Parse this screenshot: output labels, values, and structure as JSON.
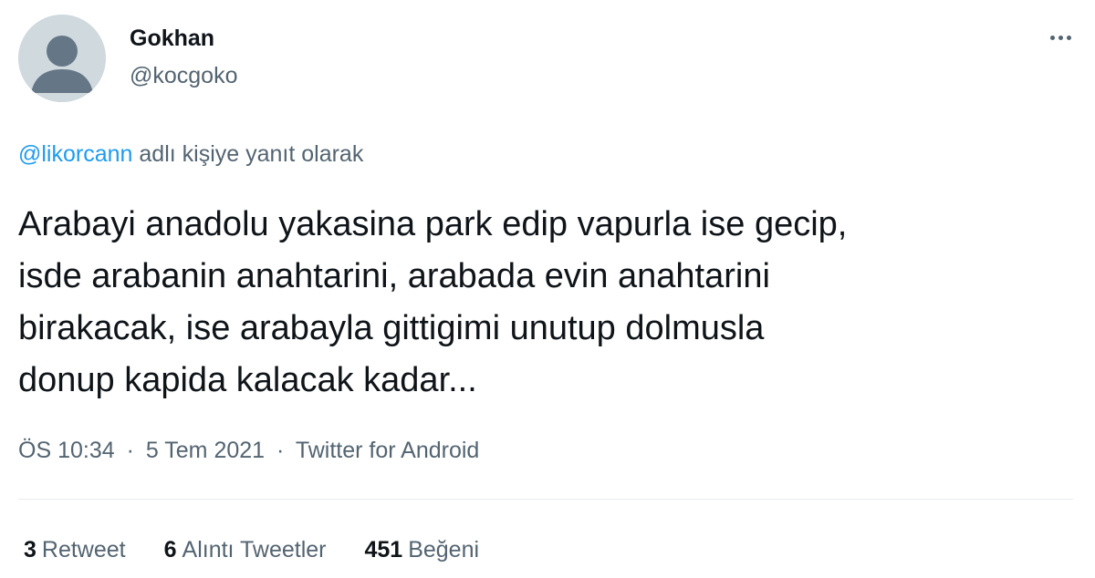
{
  "author": {
    "display_name": "Gokhan",
    "handle": "@kocgoko",
    "avatar_icon": "default-profile-icon"
  },
  "more_icon": "more-horizontal-icon",
  "reply_context": {
    "mention": "@likorcann",
    "suffix": " adlı kişiye yanıt olarak"
  },
  "tweet": {
    "text": "Arabayi anadolu yakasina park edip vapurla ise gecip,\nisde arabanin anahtarini, arabada evin anahtarini\nbirakacak, ise arabayla gittigimi unutup dolmusla\ndonup kapida kalacak kadar..."
  },
  "meta": {
    "time": "ÖS 10:34",
    "separator": "·",
    "date": "5 Tem 2021",
    "source": "Twitter for Android"
  },
  "stats": {
    "retweets": {
      "count": "3",
      "label": "Retweet"
    },
    "quotes": {
      "count": "6",
      "label": "Alıntı Tweetler"
    },
    "likes": {
      "count": "451",
      "label": "Beğeni"
    }
  },
  "colors": {
    "link": "#1d9bf0",
    "secondary_text": "#536471",
    "primary_text": "#0f1419",
    "avatar_bg": "#cfd9de",
    "avatar_fg": "#657786"
  }
}
